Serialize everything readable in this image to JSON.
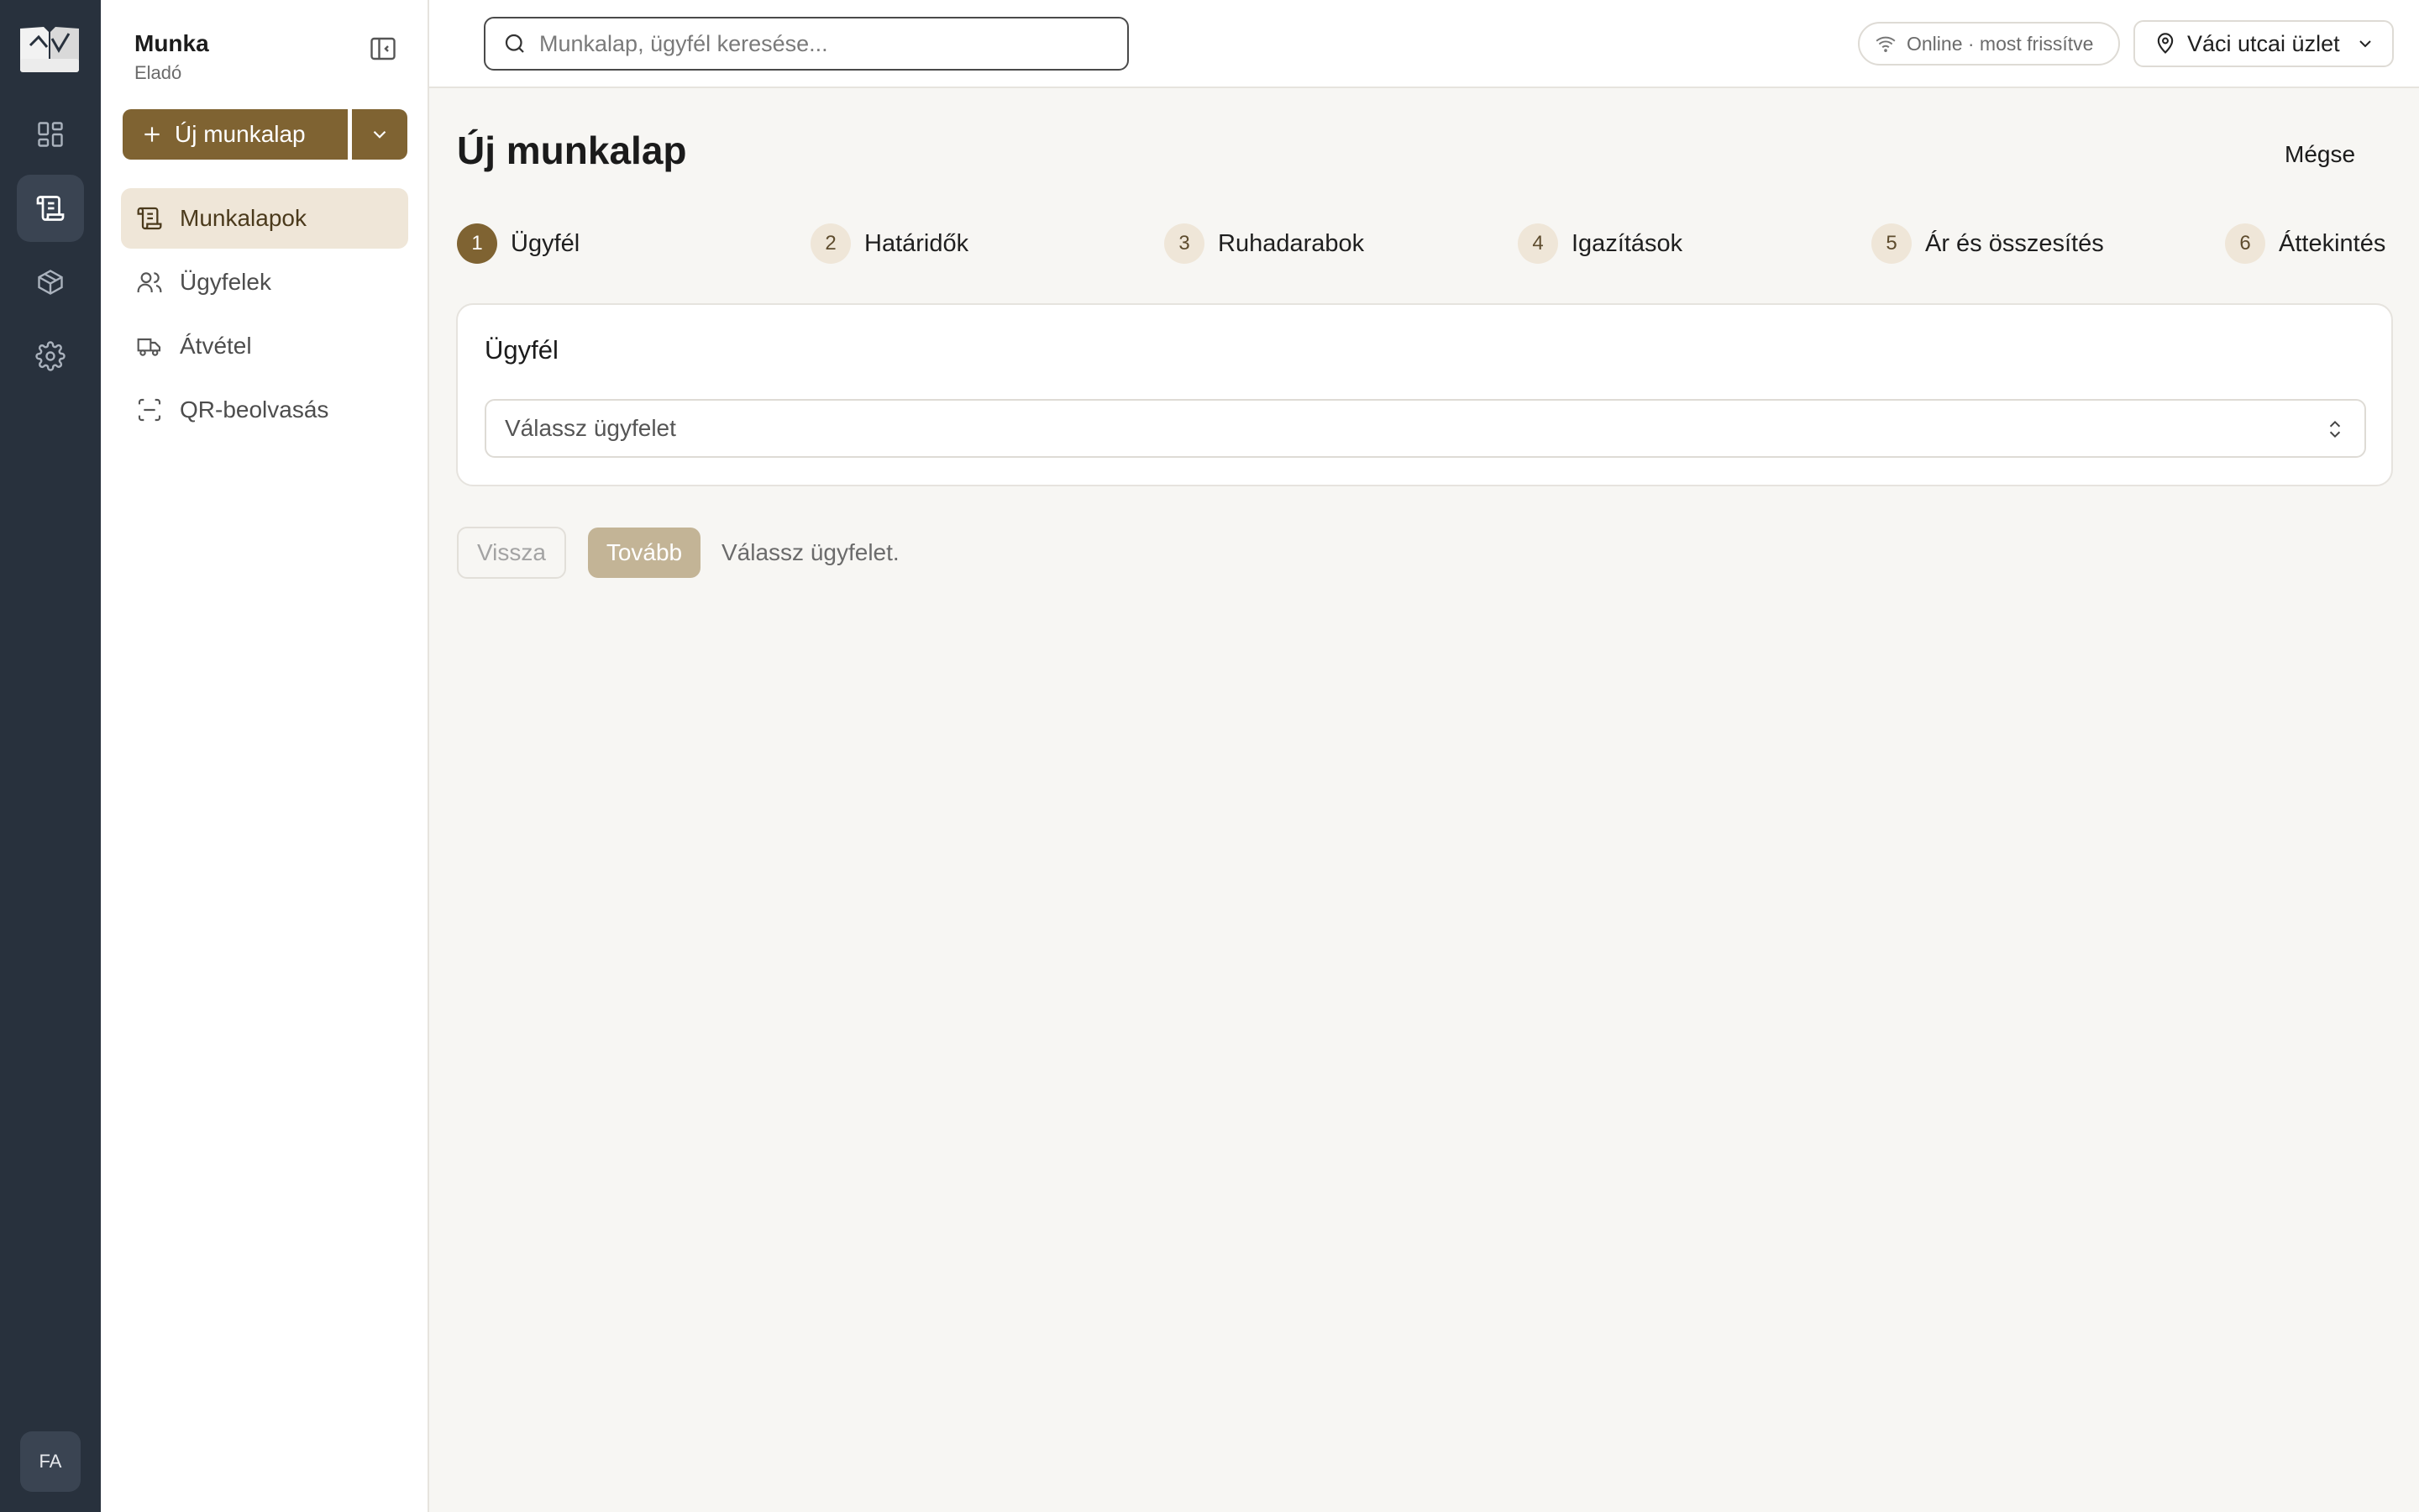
{
  "rail": {
    "avatar_initials": "FA",
    "items": [
      {
        "icon": "dashboard-icon",
        "active": false
      },
      {
        "icon": "worksheet-scroll-icon",
        "active": true
      },
      {
        "icon": "box-icon",
        "active": false
      },
      {
        "icon": "gear-icon",
        "active": false
      }
    ]
  },
  "sidebar": {
    "title": "Munka",
    "subtitle": "Eladó",
    "new_button_label": "Új munkalap",
    "items": [
      {
        "label": "Munkalapok",
        "icon": "worksheet-scroll-icon",
        "active": true
      },
      {
        "label": "Ügyfelek",
        "icon": "users-icon",
        "active": false
      },
      {
        "label": "Átvétel",
        "icon": "truck-icon",
        "active": false
      },
      {
        "label": "QR-beolvasás",
        "icon": "scan-icon",
        "active": false
      }
    ]
  },
  "header": {
    "search_placeholder": "Munkalap, ügyfél keresése...",
    "status_text": "Online · most frissítve",
    "location_label": "Váci utcai üzlet"
  },
  "main": {
    "title": "Új munkalap",
    "cancel_label": "Mégse",
    "steps": [
      {
        "number": "1",
        "label": "Ügyfél",
        "active": true
      },
      {
        "number": "2",
        "label": "Határidők",
        "active": false
      },
      {
        "number": "3",
        "label": "Ruhadarabok",
        "active": false
      },
      {
        "number": "4",
        "label": "Igazítások",
        "active": false
      },
      {
        "number": "5",
        "label": "Ár és összesítés",
        "active": false
      },
      {
        "number": "6",
        "label": "Áttekintés",
        "active": false
      }
    ],
    "card_title": "Ügyfél",
    "select_placeholder": "Válassz ügyfelet",
    "back_label": "Vissza",
    "next_label": "Tovább",
    "hint_text": "Válassz ügyfelet."
  },
  "colors": {
    "accent": "#7f6332",
    "accent_light": "#efe6d8",
    "rail_bg": "#28313d",
    "next_disabled": "#c3b496"
  }
}
